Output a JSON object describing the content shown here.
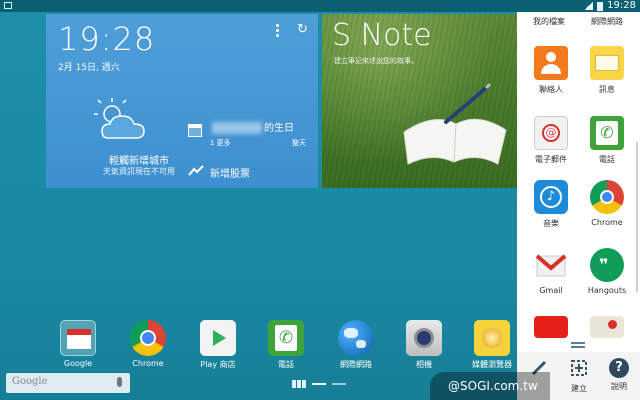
{
  "statusbar": {
    "time": "19:28"
  },
  "weather_widget": {
    "time": "19:28",
    "date": "2月 15日, 週六",
    "city": "輕觸新增城市",
    "status": "天氣資訊現在不可用",
    "event_title": "的生日",
    "event_more": "1 更多",
    "event_days": "整天",
    "stock_label": "新增股票"
  },
  "snote_widget": {
    "title": "S Note",
    "subtitle": "建立筆記來述說您的故事。"
  },
  "panel": {
    "top_left": "我的檔案",
    "top_right": "網際網路",
    "apps": [
      {
        "label": "聯絡人",
        "icon": "contacts-icon"
      },
      {
        "label": "訊息",
        "icon": "messages-icon"
      },
      {
        "label": "電子郵件",
        "icon": "email-icon"
      },
      {
        "label": "電話",
        "icon": "phone-icon"
      },
      {
        "label": "音樂",
        "icon": "music-icon"
      },
      {
        "label": "Chrome",
        "icon": "chrome-icon"
      },
      {
        "label": "Gmail",
        "icon": "gmail-icon"
      },
      {
        "label": "Hangouts",
        "icon": "hangouts-icon"
      }
    ],
    "bottom": {
      "create": "建立",
      "help": "說明"
    }
  },
  "dock": [
    {
      "label": "Google",
      "icon": "google-folder-icon"
    },
    {
      "label": "Chrome",
      "icon": "chrome-icon"
    },
    {
      "label": "Play 商店",
      "icon": "play-store-icon"
    },
    {
      "label": "電話",
      "icon": "phone-icon"
    },
    {
      "label": "網際網路",
      "icon": "internet-icon"
    },
    {
      "label": "相機",
      "icon": "camera-icon"
    },
    {
      "label": "媒體瀏覽器",
      "icon": "media-browser-icon"
    }
  ],
  "search": {
    "label": "Google"
  },
  "watermark": "@SOGI.com.tw",
  "colors": {
    "wallpaper": "#1a8aa3",
    "weather_bg": "#4596d3",
    "panel_bg": "#ffffff"
  }
}
